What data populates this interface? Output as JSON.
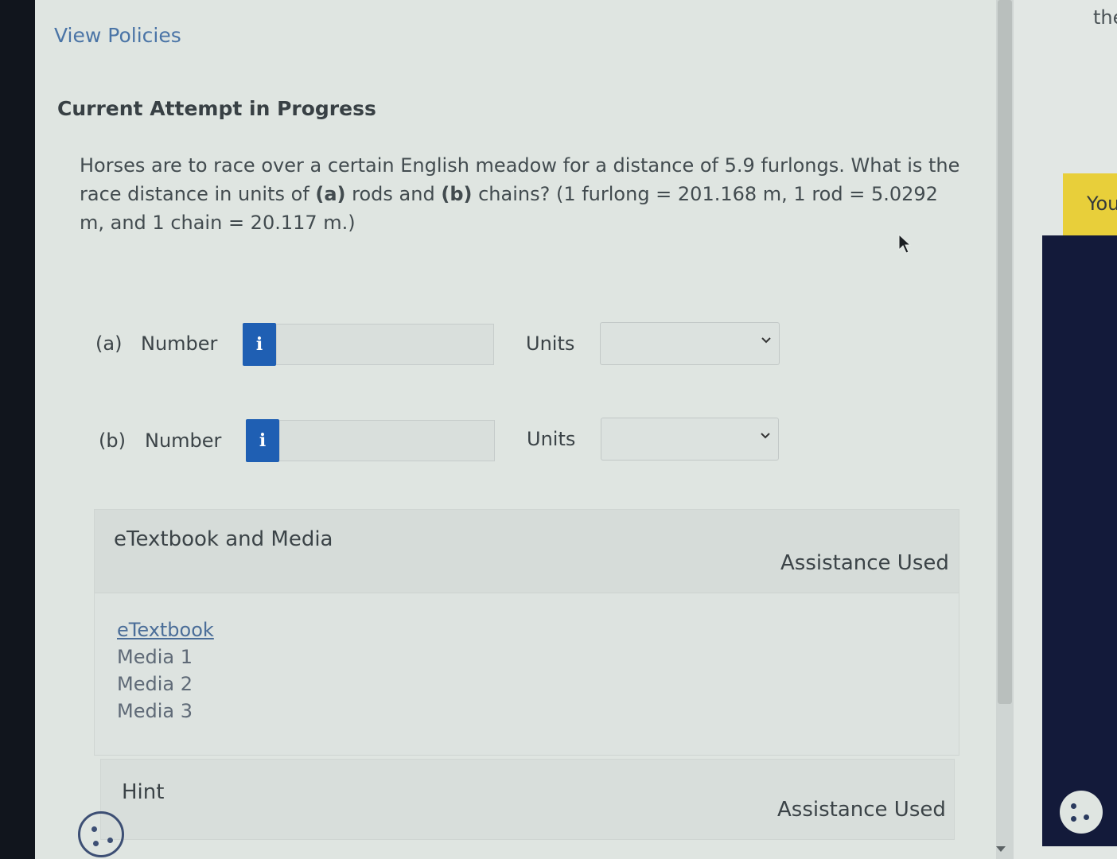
{
  "nav": {
    "view_policies": "View Policies"
  },
  "attempt": {
    "heading": "Current Attempt in Progress"
  },
  "question": {
    "text_1": "Horses are to race over a certain English meadow for a distance of 5.9 furlongs. What is the race distance in units of ",
    "bold_a": "(a)",
    "text_2": " rods and ",
    "bold_b": "(b)",
    "text_3": " chains? (1 furlong = 201.168 m, 1 rod = 5.0292 m, and 1 chain = 20.117 m.)"
  },
  "parts": [
    {
      "label": "(a)",
      "number_label": "Number",
      "info_icon": "i",
      "value": "",
      "units_label": "Units",
      "units_value": ""
    },
    {
      "label": "(b)",
      "number_label": "Number",
      "info_icon": "i",
      "value": "",
      "units_label": "Units",
      "units_value": ""
    }
  ],
  "etextbook": {
    "title": "eTextbook and Media",
    "assistance": "Assistance Used",
    "items": [
      "eTextbook",
      "Media 1",
      "Media 2",
      "Media 3"
    ]
  },
  "hint": {
    "title": "Hint",
    "assistance": "Assistance Used"
  },
  "right_panel": {
    "top_text": "the",
    "yellow_text": "You"
  },
  "colors": {
    "info_button": "#1f5fb3",
    "banner_yellow": "#e8cf3a",
    "panel_navy": "#131a3a",
    "link": "#4a74a6"
  },
  "icons": {
    "info": "info-icon",
    "chevron": "chevron-down-icon",
    "cookie": "cookie-icon",
    "cursor": "cursor-arrow-icon"
  }
}
